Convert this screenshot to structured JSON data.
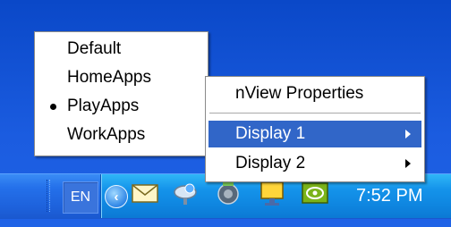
{
  "profile_menu": {
    "items": [
      {
        "label": "Default",
        "checked": false
      },
      {
        "label": "HomeApps",
        "checked": false
      },
      {
        "label": "PlayApps",
        "checked": true
      },
      {
        "label": "WorkApps",
        "checked": false
      }
    ]
  },
  "nview_menu": {
    "items": [
      {
        "label": "nView Properties",
        "has_submenu": false
      },
      {
        "label": "Display 1",
        "has_submenu": true,
        "selected": true
      },
      {
        "label": "Display 2",
        "has_submenu": true
      }
    ]
  },
  "taskbar": {
    "language": "EN",
    "clock": "7:52 PM",
    "tray_icons": [
      "expand-chevron-icon",
      "mail-envelope-icon",
      "network-globe-icon",
      "audio-speaker-icon",
      "monitor-icon",
      "nvidia-icon"
    ]
  },
  "colors": {
    "desktop": "#1d58d8",
    "taskbar": "#2470ea",
    "tray": "#1493ea",
    "menu_highlight": "#3166c8"
  }
}
